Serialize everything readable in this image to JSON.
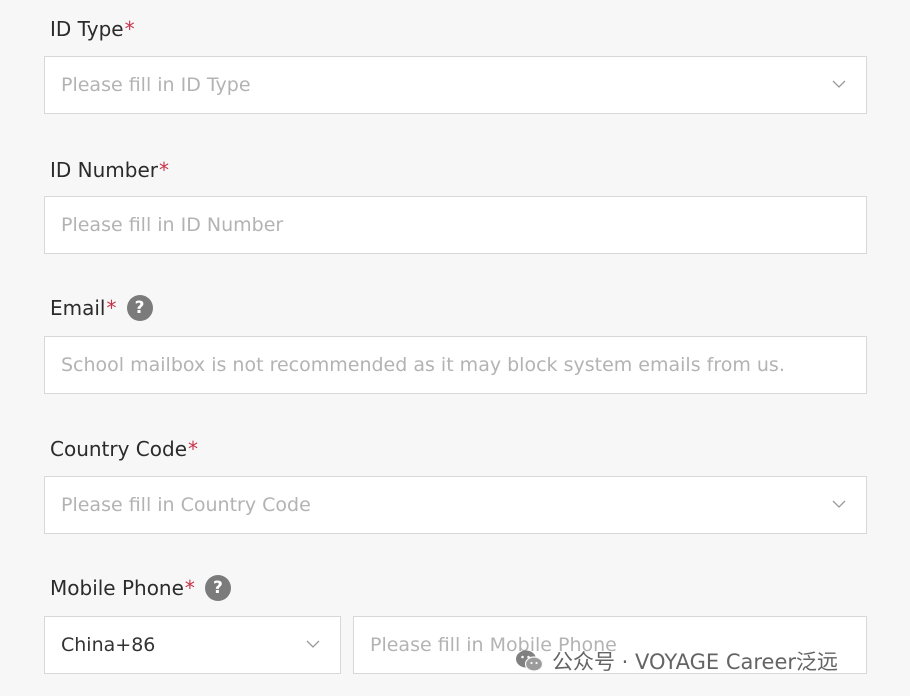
{
  "id_type": {
    "label": "ID Type",
    "required_mark": "*",
    "placeholder": "Please fill in ID Type",
    "icon": "chevron-down-icon"
  },
  "id_number": {
    "label": "ID Number",
    "required_mark": "*",
    "placeholder": "Please fill in ID Number"
  },
  "email": {
    "label": "Email",
    "required_mark": "*",
    "help": "?",
    "placeholder": "School mailbox is not recommended as it may block system emails from us."
  },
  "country_code": {
    "label": "Country Code",
    "required_mark": "*",
    "placeholder": "Please fill in Country Code",
    "icon": "chevron-down-icon"
  },
  "mobile_phone": {
    "label": "Mobile Phone",
    "required_mark": "*",
    "help": "?",
    "country_select_value": "China+86",
    "placeholder": "Please fill in Mobile Phone"
  },
  "watermark": {
    "text": "公众号 · VOYAGE Career泛远",
    "icon": "wechat-icon"
  },
  "colors": {
    "required": "#c8334a",
    "placeholder": "#b3b3b3",
    "border": "#d8d8d8",
    "help_badge": "#7b7b7b"
  }
}
